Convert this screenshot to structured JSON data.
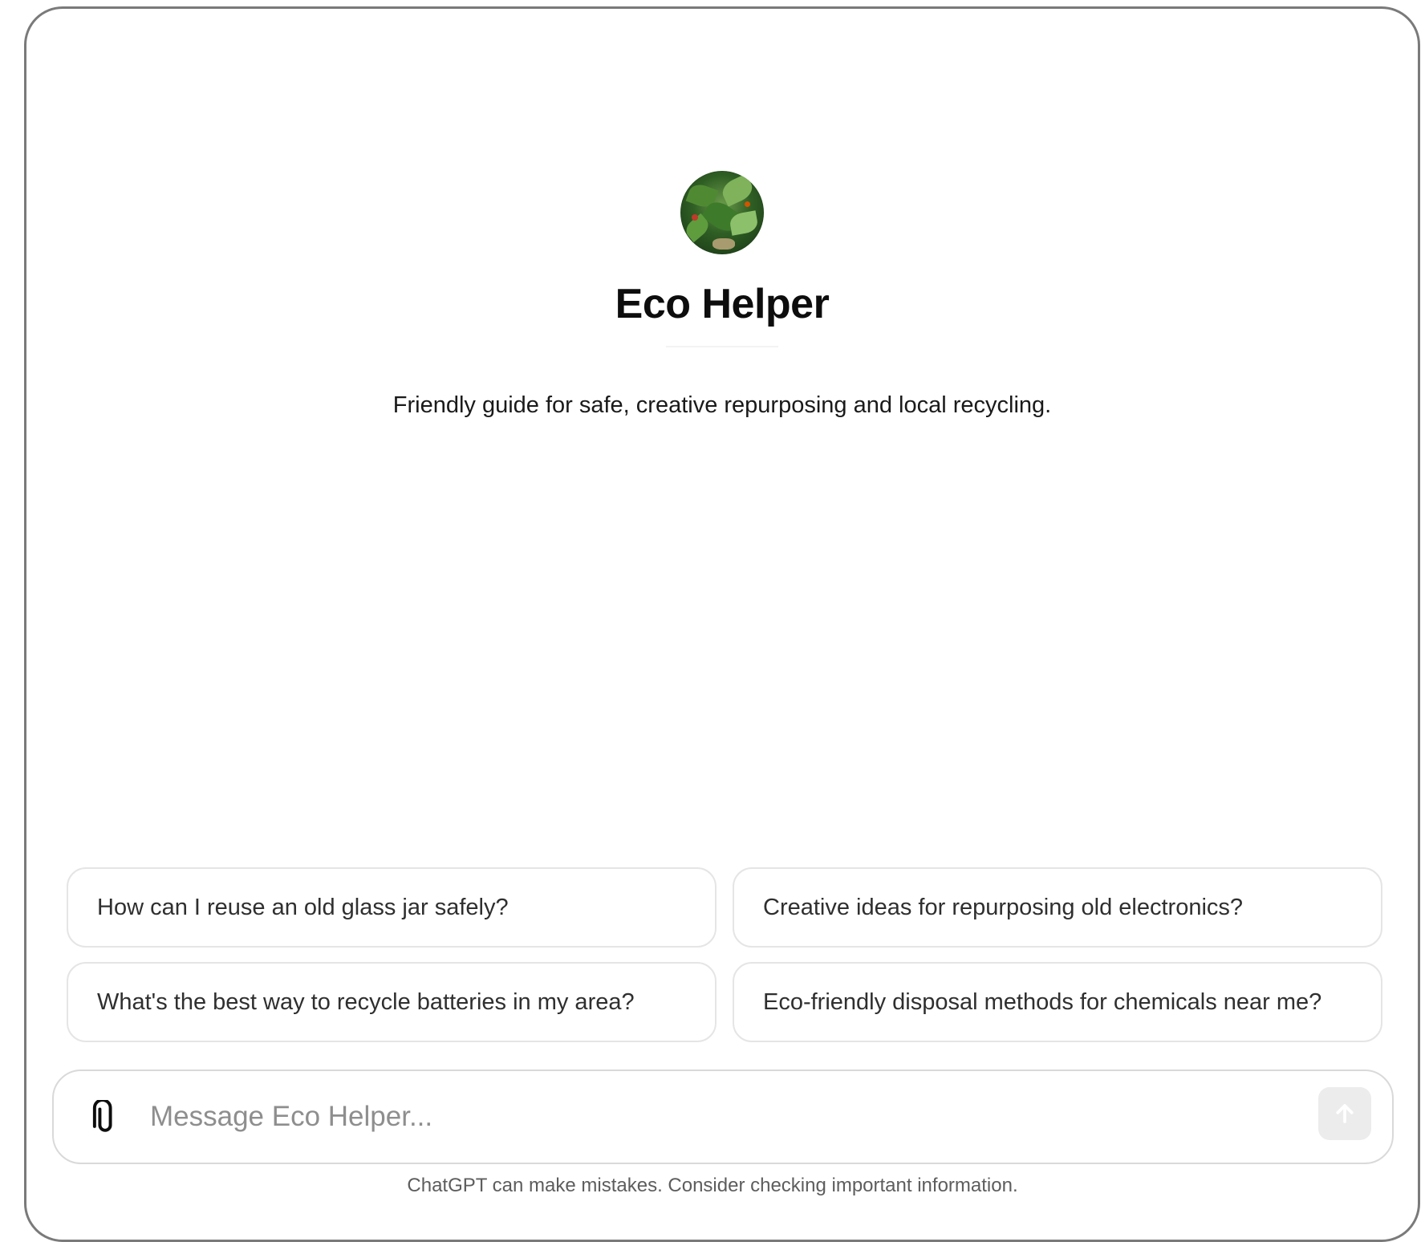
{
  "gpt": {
    "name": "Eco Helper",
    "description": "Friendly guide for safe, creative repurposing and local recycling."
  },
  "suggestions": [
    "How can I reuse an old glass jar safely?",
    "Creative ideas for repurposing old electronics?",
    "What's the best way to recycle batteries in my area?",
    "Eco-friendly disposal methods for chemicals near me?"
  ],
  "composer": {
    "placeholder": "Message Eco Helper...",
    "attach_icon": "paperclip-icon",
    "send_icon": "arrow-up-icon"
  },
  "footer": {
    "disclaimer": "ChatGPT can make mistakes. Consider checking important information."
  },
  "colors": {
    "border": "#7a7a7a",
    "chip_border": "#e5e5e5",
    "send_bg": "#ececec",
    "text_primary": "#0d0d0d",
    "text_muted": "#5d5d5d"
  }
}
